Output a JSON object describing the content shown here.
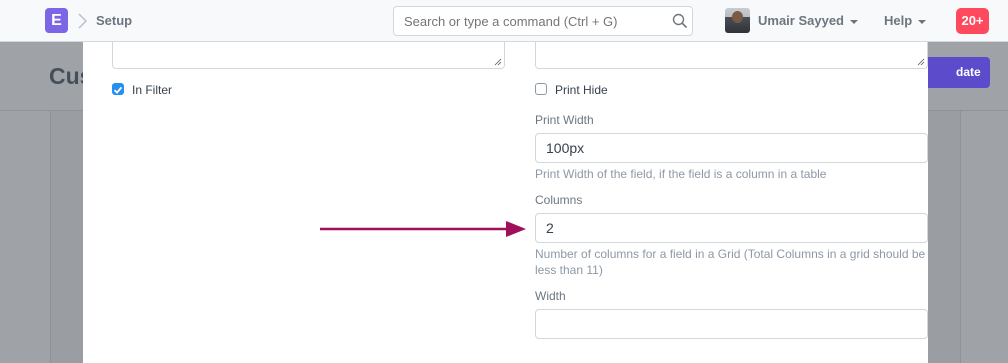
{
  "navbar": {
    "logo_letter": "E",
    "breadcrumb": "Setup",
    "search_placeholder": "Search or type a command (Ctrl + G)",
    "user_name": "Umair Sayyed",
    "help_label": "Help",
    "notification_count": "20+"
  },
  "background_page": {
    "title": "Cus",
    "primary_button": "date"
  },
  "form": {
    "in_filter": {
      "label": "In Filter",
      "checked": true
    },
    "print_hide": {
      "label": "Print Hide",
      "checked": false
    },
    "print_width": {
      "label": "Print Width",
      "value": "100px",
      "description": "Print Width of the field, if the field is a column in a table"
    },
    "columns": {
      "label": "Columns",
      "value": "2",
      "description": "Number of columns for a field in a Grid (Total Columns in a grid should be less than 11)"
    },
    "width": {
      "label": "Width",
      "value": ""
    }
  },
  "colors": {
    "accent": "#7c66e6",
    "checkbox": "#2490ef",
    "notification": "#ff4a5d",
    "annotation_arrow": "#a0105a"
  }
}
